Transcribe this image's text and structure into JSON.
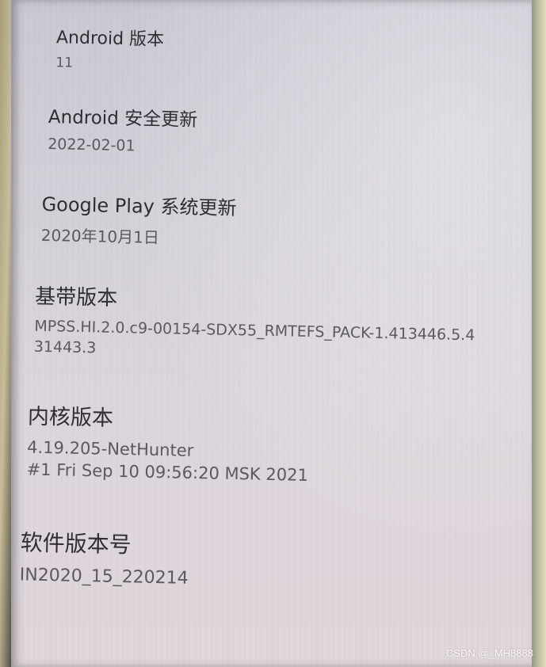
{
  "settings": {
    "android_version": {
      "title": "Android 版本",
      "value": "11"
    },
    "security_update": {
      "title": "Android 安全更新",
      "value": "2022-02-01"
    },
    "play_update": {
      "title": "Google Play 系统更新",
      "value": "2020年10月1日"
    },
    "baseband": {
      "title": "基带版本",
      "value_line1": "MPSS.HI.2.0.c9-00154-SDX55_RMTEFS_PACK-1.413446.5.4",
      "value_line2": "31443.3"
    },
    "kernel": {
      "title": "内核版本",
      "value_line1": "4.19.205-NetHunter",
      "value_line2": "#1 Fri Sep 10 09:56:20 MSK 2021"
    },
    "build": {
      "title": "软件版本号",
      "value": "IN2020_15_220214"
    }
  },
  "watermark": "CSDN @_MH8888",
  "colors": {
    "title": "#2f2f33",
    "value": "#5b5a5f",
    "screen": "#d3d0d8"
  }
}
